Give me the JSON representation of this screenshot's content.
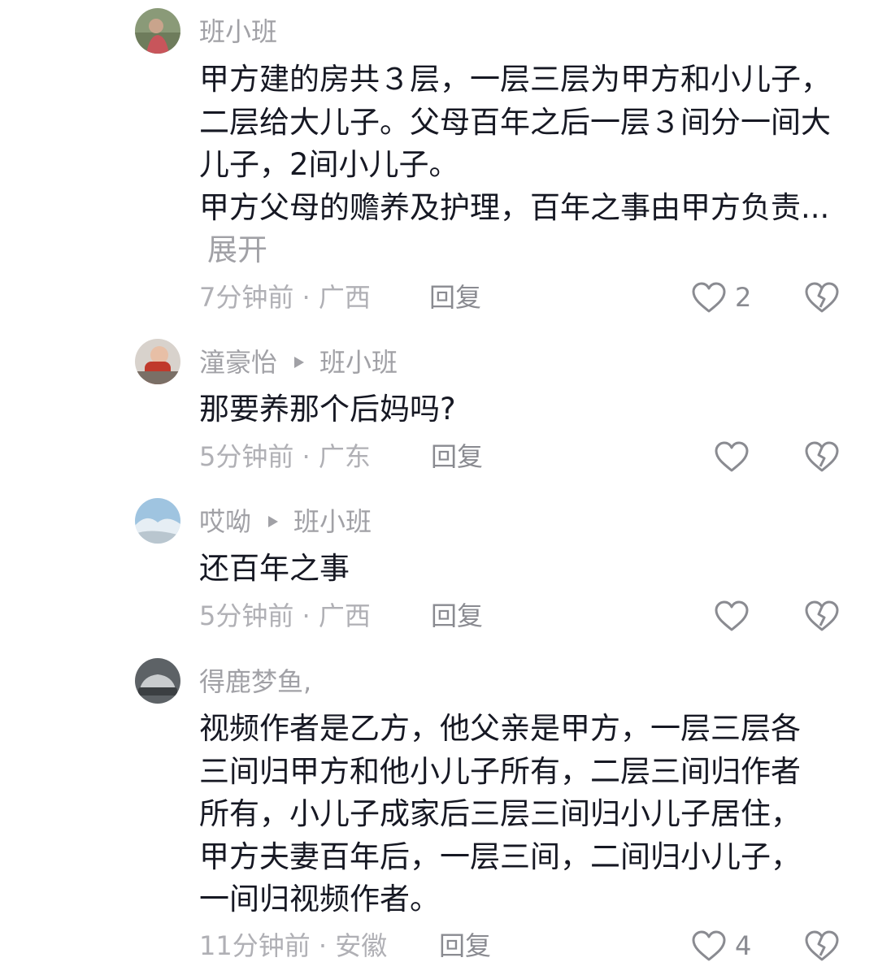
{
  "comments": [
    {
      "username": "班小班",
      "reply_to": "",
      "paragraphs": [
        "甲方建的房共３层，一层三层为甲方和小儿子，二层给大儿子。父母百年之后一层３间分一间大儿子，2间小儿子。",
        "甲方父母的赡养及护理，百年之事由甲方负责..."
      ],
      "expand_label": "展开",
      "time_location": "7分钟前 · 广西",
      "reply_label": "回复",
      "like_count": "2",
      "avatar_icon": "avatar-person-icon"
    },
    {
      "username": "潼豪怡",
      "reply_to": "班小班",
      "paragraphs": [
        "那要养那个后妈吗?"
      ],
      "time_location": "5分钟前 · 广东",
      "reply_label": "回复",
      "like_count": "",
      "avatar_icon": "avatar-child-icon"
    },
    {
      "username": "哎呦",
      "reply_to": "班小班",
      "paragraphs": [
        "还百年之事"
      ],
      "time_location": "5分钟前 · 广西",
      "reply_label": "回复",
      "like_count": "",
      "avatar_icon": "avatar-landscape-icon"
    },
    {
      "username": "得鹿梦鱼,",
      "reply_to": "",
      "paragraphs": [
        "视频作者是乙方，他父亲是甲方，一层三层各三间归甲方和他小儿子所有，二层三间归作者所有，小儿子成家后三层三间归小儿子居住，甲方夫妻百年后，一层三间，二间归小儿子，一间归视频作者。"
      ],
      "time_location": "11分钟前 · 安徽",
      "reply_label": "回复",
      "like_count": "4",
      "avatar_icon": "avatar-car-icon"
    }
  ],
  "colors": {
    "text_primary": "#161823",
    "text_secondary": "#a1a1a6",
    "icon_gray": "#8a8b91"
  }
}
